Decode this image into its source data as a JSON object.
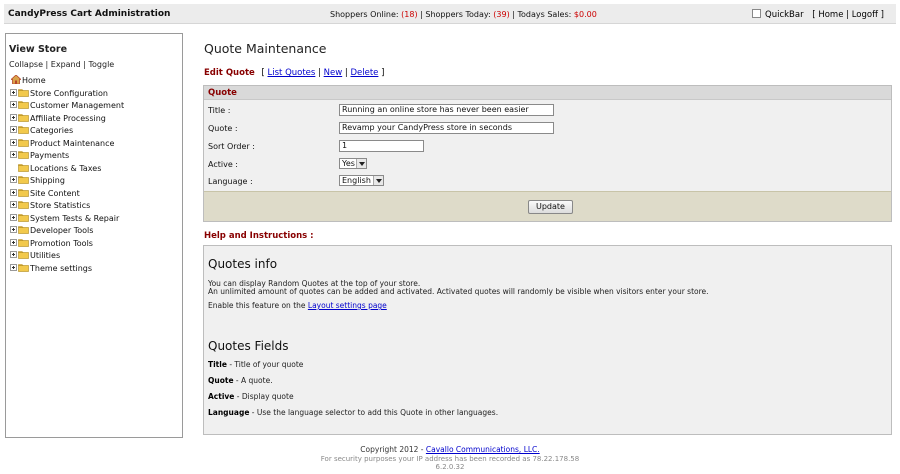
{
  "topbar": {
    "app_title": "CandyPress Cart Administration",
    "shoppers_online_label": "Shoppers Online:",
    "shoppers_online_value": "(18)",
    "shoppers_today_label": "Shoppers Today:",
    "shoppers_today_value": "(39)",
    "todays_sales_label": "Todays Sales:",
    "todays_sales_value": "$0.00",
    "quickbar_label": "QuickBar",
    "home_link": "Home",
    "logoff_link": "Logoff"
  },
  "sidebar": {
    "title": "View Store",
    "collapse": "Collapse",
    "expand": "Expand",
    "toggle": "Toggle",
    "home": "Home",
    "items": [
      {
        "label": "Store Configuration",
        "expandable": true
      },
      {
        "label": "Customer Management",
        "expandable": true
      },
      {
        "label": "Affiliate Processing",
        "expandable": true
      },
      {
        "label": "Categories",
        "expandable": true
      },
      {
        "label": "Product Maintenance",
        "expandable": true
      },
      {
        "label": "Payments",
        "expandable": true
      },
      {
        "label": "Locations & Taxes",
        "expandable": false
      },
      {
        "label": "Shipping",
        "expandable": true
      },
      {
        "label": "Site Content",
        "expandable": true
      },
      {
        "label": "Store Statistics",
        "expandable": true
      },
      {
        "label": "System Tests & Repair",
        "expandable": true
      },
      {
        "label": "Developer Tools",
        "expandable": true
      },
      {
        "label": "Promotion Tools",
        "expandable": true
      },
      {
        "label": "Utilities",
        "expandable": true
      },
      {
        "label": "Theme settings",
        "expandable": true
      }
    ]
  },
  "main": {
    "page_title": "Quote Maintenance",
    "subnav": {
      "current": "Edit Quote",
      "list_quotes": "List Quotes",
      "new": "New",
      "delete": "Delete"
    },
    "form": {
      "header": "Quote",
      "title_label": "Title :",
      "title_value": "Running an online store has never been easier",
      "quote_label": "Quote :",
      "quote_value": "Revamp your CandyPress store in seconds",
      "sort_label": "Sort Order :",
      "sort_value": "1",
      "active_label": "Active :",
      "active_value": "Yes",
      "language_label": "Language :",
      "language_value": "English",
      "update_button": "Update"
    },
    "help": {
      "title": "Help and Instructions :",
      "info_heading": "Quotes info",
      "info_line1": "You can display Random Quotes at the top of your store.",
      "info_line2": "An unlimited amount of quotes can be added and activated. Activated quotes will randomly be visible when visitors enter your store.",
      "enable_prefix": "Enable this feature on the",
      "enable_link": "Layout settings page",
      "fields_heading": "Quotes Fields",
      "fields": [
        {
          "name": "Title",
          "desc": " - Title of your quote"
        },
        {
          "name": "Quote",
          "desc": " - A quote."
        },
        {
          "name": "Active",
          "desc": " - Display quote"
        },
        {
          "name": "Language",
          "desc": " - Use the language selector to add this Quote in other languages."
        }
      ]
    }
  },
  "footer": {
    "copyright_prefix": "Copyright 2012 -",
    "company_link": "Cavallo Communications, LLC.",
    "security_note": "For security purposes your IP address has been recorded as 78.22.178.58",
    "version": "6.2.0.32"
  },
  "colors": {
    "accent_red": "#880000",
    "stat_red": "#cc0000",
    "link_blue": "#0000cc",
    "folder_yellow": "#f2c94c"
  }
}
